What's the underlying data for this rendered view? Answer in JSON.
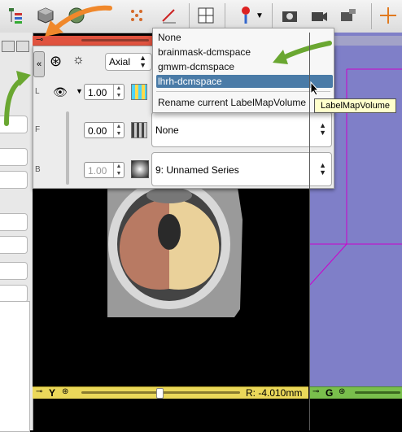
{
  "icons": {
    "toolbar": [
      "module-tree-icon",
      "cube-icon",
      "globe-volume-icon",
      "grid-dots-icon",
      "measure-icon",
      "layout-grid-icon",
      "fiducial-pin-icon",
      "screenshot-camera-icon",
      "video-camera-icon",
      "scene-camera-icon",
      "crosshair-icon"
    ],
    "controller": [
      "collapse-icon",
      "link-icon",
      "visibility-eye-icon",
      "outline-icon",
      "lightbox-icon",
      "label-icon",
      "foreground-icon",
      "background-icon"
    ]
  },
  "controller": {
    "collapse_label": "«",
    "orientation": "Axial",
    "label_opacity": "1.00",
    "fg_opacity": "0.00",
    "bg_opacity": "1.00",
    "fg_volume": "None",
    "bg_volume": "9: Unnamed Series",
    "row_labels": [
      "L",
      "F",
      "B"
    ]
  },
  "dropdown": {
    "items": [
      "None",
      "brainmask-dcmspace",
      "gmwm-dcmspace",
      "lhrh-dcmspace"
    ],
    "selected_index": 3,
    "action": "Rename current LabelMapVolume"
  },
  "tooltip": "LabelMapVolume",
  "slice_views": {
    "yellow": {
      "letter": "Y",
      "readout": "R: -4.010mm"
    },
    "green": {
      "letter": "G"
    }
  },
  "colors": {
    "red": "#e0533f",
    "yellow": "#ebd85a",
    "green": "#79bf4c",
    "selection": "#4a7ba7",
    "left_hemisphere": "#b87a63",
    "right_hemisphere": "#ead19a",
    "arrow_orange": "#f0882b",
    "arrow_green": "#6aa731",
    "view3d_box": "#cc00cc"
  }
}
